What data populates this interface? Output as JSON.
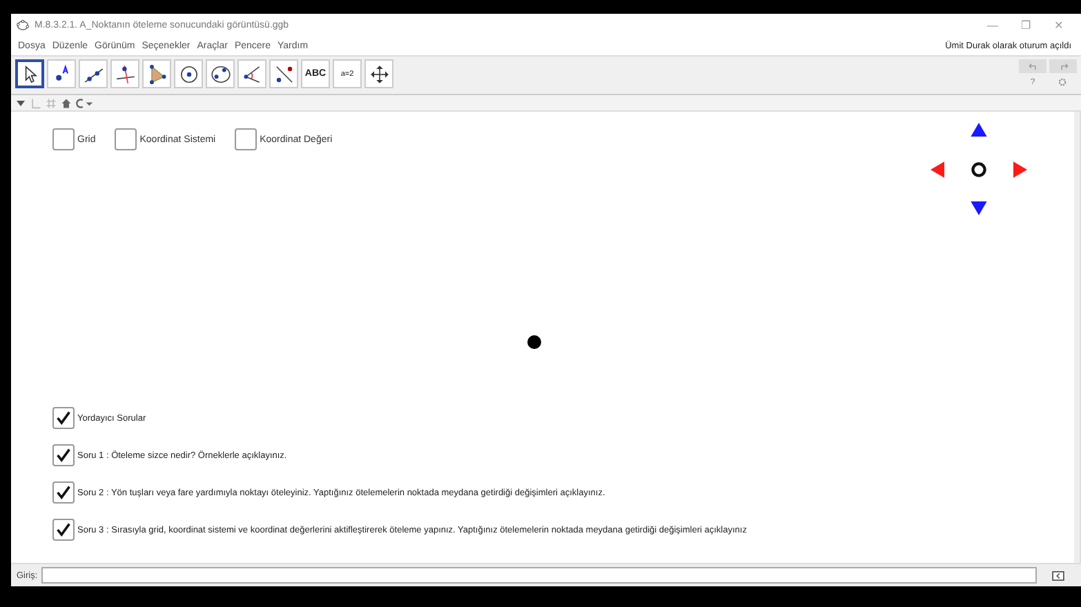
{
  "window": {
    "title": "M.8.3.2.1. A_Noktanın öteleme sonucundaki görüntüsü.ggb",
    "controls": [
      "—",
      "❐",
      "✕"
    ]
  },
  "menu": [
    "Dosya",
    "Düzenle",
    "Görünüm",
    "Seçenekler",
    "Araçlar",
    "Pencere",
    "Yardım"
  ],
  "login": "Ümit Durak olarak oturum açıldı",
  "tools": [
    {
      "kind": "move",
      "selected": true
    },
    {
      "kind": "point",
      "selected": false
    },
    {
      "kind": "line",
      "selected": false
    },
    {
      "kind": "perpendicular",
      "selected": false
    },
    {
      "kind": "polygon",
      "selected": false
    },
    {
      "kind": "circle",
      "selected": false
    },
    {
      "kind": "conic",
      "selected": false
    },
    {
      "kind": "angle",
      "selected": false
    },
    {
      "kind": "reflect",
      "selected": false
    },
    {
      "kind": "text",
      "label": "ABC",
      "selected": false
    },
    {
      "kind": "slider",
      "label": "a=2",
      "selected": false
    },
    {
      "kind": "move-view",
      "selected": false
    }
  ],
  "side_buttons": {
    "help": "?"
  },
  "top_checkboxes": [
    {
      "label": "Grid",
      "checked": false
    },
    {
      "label": "Koordinat Sistemi",
      "checked": false
    },
    {
      "label": "Koordinat Değeri",
      "checked": false
    }
  ],
  "question_checkboxes": [
    {
      "label": "Yordayıcı Sorular",
      "checked": true
    },
    {
      "label": "Soru 1 : Öteleme sizce nedir? Örneklerle açıklayınız.",
      "checked": true
    },
    {
      "label": "Soru 2 : Yön tuşları veya fare yardımıyla noktayı öteleyiniz. Yaptığınız ötelemelerin noktada meydana getirdiği değişimleri açıklayınız.",
      "checked": true
    },
    {
      "label": "Soru 3 : Sırasıyla grid, koordinat sistemi ve koordinat değerlerini aktifleştirerek öteleme yapınız. Yaptığınız ötelemelerin noktada meydana getirdiği değişimleri açıklayınız",
      "checked": true
    }
  ],
  "input_bar": {
    "label": "Giriş:"
  }
}
